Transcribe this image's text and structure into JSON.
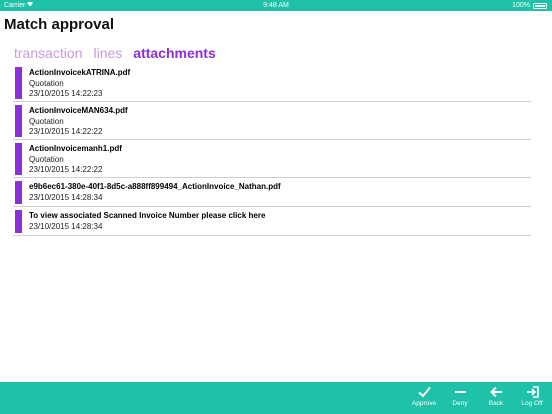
{
  "status_bar": {
    "carrier": "Carrier",
    "time": "9:48 AM",
    "battery": "100%"
  },
  "page": {
    "title": "Match approval"
  },
  "tabs": [
    {
      "label": "transaction",
      "active": false
    },
    {
      "label": "lines",
      "active": false
    },
    {
      "label": "attachments",
      "active": true
    }
  ],
  "attachments": [
    {
      "filename": "ActionInvoicekATRINA.pdf",
      "type": "Quotation",
      "date": "23/10/2015 14:22:23"
    },
    {
      "filename": "ActionInvoiceMAN634.pdf",
      "type": "Quotation",
      "date": "23/10/2015 14:22:22"
    },
    {
      "filename": "ActionInvoicemanh1.pdf",
      "type": "Quotation",
      "date": "23/10/2015 14:22:22"
    },
    {
      "filename": "e9b6ec61-380e-40f1-8d5c-a888ff899494_ActionInvoice_Nathan.pdf",
      "date": "23/10/2015 14:28:34"
    },
    {
      "filename": "To view associated Scanned Invoice Number please click here",
      "date": "23/10/2015 14:28:34"
    }
  ],
  "toolbar": {
    "approve_label": "Approve",
    "deny_label": "Deny",
    "back_label": "Back",
    "logoff_label": "Log Off"
  },
  "colors": {
    "accent": "#1fc1a8",
    "purple": "#8b2fd6",
    "tab_inactive": "#c79be0"
  },
  "icons": {
    "approve": "checkmark-icon",
    "deny": "minus-icon",
    "back": "arrow-left-icon",
    "logoff": "logout-icon",
    "wifi": "wifi-icon",
    "battery": "battery-icon"
  }
}
